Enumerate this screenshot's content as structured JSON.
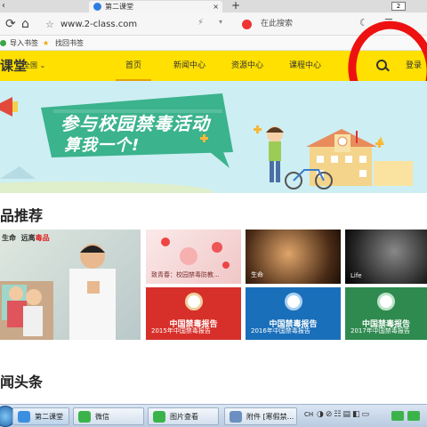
{
  "browser": {
    "tab_active": "第二课堂",
    "tab_new": "新标签页",
    "tab_count": "2",
    "url": "www.2-class.com",
    "search_placeholder": "在此搜索",
    "bookmarks": [
      "导入书签",
      "找回书签"
    ]
  },
  "site": {
    "logo_text": "课堂",
    "region": "全国",
    "nav": [
      "首页",
      "新闻中心",
      "资源中心",
      "课程中心"
    ],
    "login": "登录"
  },
  "banner": {
    "line1": "参与校园禁毒活动",
    "line2": "算我一个!"
  },
  "section1": {
    "title": "品推荐",
    "hero_text_a": "生命",
    "hero_text_b": "远离",
    "hero_text_c": "毒品",
    "cards": [
      {
        "label": "致青春：校园禁毒防教..."
      },
      {
        "label": "生命"
      },
      {
        "label": "Life"
      },
      {
        "label": "2015年中国禁毒报告",
        "report": "中国禁毒报告"
      },
      {
        "label": "2016年中国禁毒报告",
        "report": "中国禁毒报告"
      },
      {
        "label": "2017年中国禁毒报告",
        "report": "中国禁毒报告"
      }
    ]
  },
  "section2": {
    "title": "闻头条"
  },
  "taskbar": {
    "items": [
      "第二课堂",
      "微信",
      "图片查看",
      "附件 [寒假禁..."
    ],
    "tray": "CH"
  },
  "colors": {
    "nav_yellow": "#ffe000",
    "banner_green": "#3bb38c",
    "report_red": "#d7302a",
    "report_blue": "#1a6fba",
    "report_green": "#2f8a4f",
    "annotation_red": "#ee1111"
  }
}
